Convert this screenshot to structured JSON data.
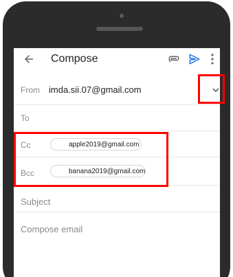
{
  "appbar": {
    "title": "Compose",
    "icons": [
      "back-arrow-icon",
      "attach-icon",
      "send-icon",
      "more-vert-icon"
    ]
  },
  "from": {
    "label": "From",
    "value": "imda.sii.07@gmail.com"
  },
  "to": {
    "label": "To"
  },
  "cc": {
    "label": "Cc",
    "chip": "apple2019@gmail.com"
  },
  "bcc": {
    "label": "Bcc",
    "chip": "banana2019@gmail.com"
  },
  "subject": {
    "placeholder": "Subject"
  },
  "body": {
    "placeholder": "Compose email"
  },
  "colors": {
    "accent": "#1a73e8",
    "highlight": "#ff0000",
    "frame": "#2b2b2b"
  }
}
